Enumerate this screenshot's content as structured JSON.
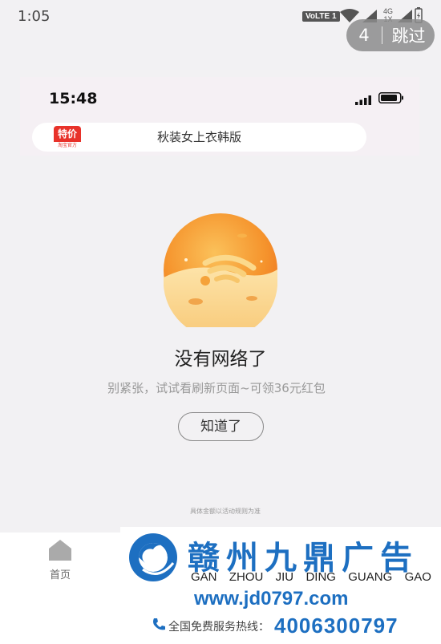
{
  "status_bar": {
    "time": "1:05",
    "volte": "VoLTE 1",
    "network_4g": "4G",
    "network_1x": "1X"
  },
  "skip": {
    "count": "4",
    "label": "跳过"
  },
  "inner_screen": {
    "time": "15:48",
    "logo_text": "特价",
    "logo_sub": "淘宝官方",
    "search_text": "秋装女上衣韩版"
  },
  "no_network": {
    "title": "没有网络了",
    "subtitle": "别紧张，试试看刷新页面~可领36元红包",
    "button": "知道了",
    "note": "具体金额以活动规则为准"
  },
  "tab_bar": {
    "home_label": "首页"
  },
  "ad": {
    "cn_name": "赣州九鼎广告",
    "pinyin": [
      "GAN",
      "ZHOU",
      "JIU",
      "DING",
      "GUANG",
      "GAO"
    ],
    "url": "www.jd0797.com",
    "hotline_label": "全国免费服务热线：",
    "hotline_number": "4006300797"
  },
  "colors": {
    "accent_orange": "#f5a23a",
    "brand_red": "#e8322a",
    "ad_blue": "#1d6fc1"
  }
}
